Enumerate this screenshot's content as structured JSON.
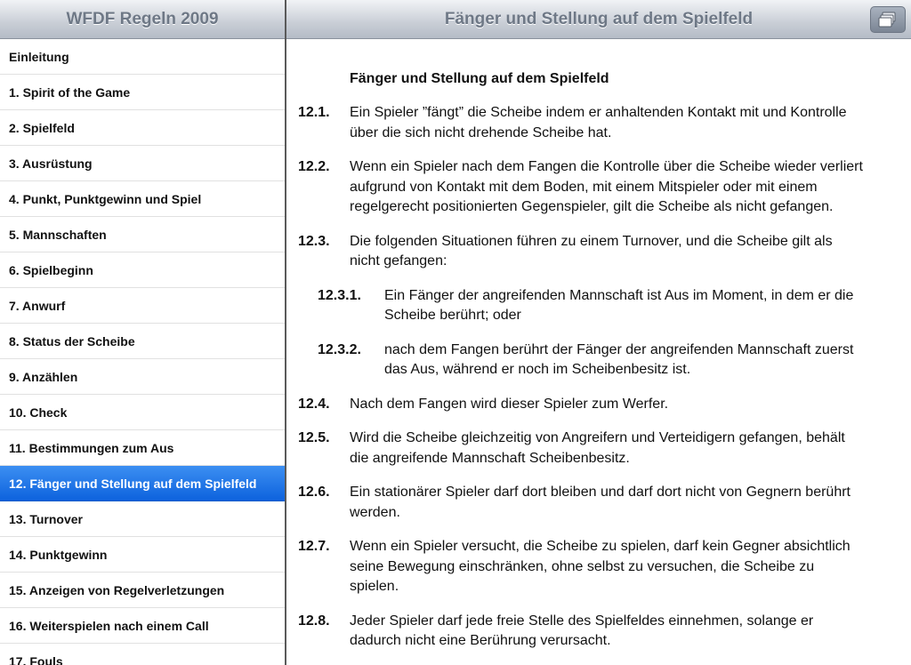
{
  "left_header": {
    "title": "WFDF Regeln 2009"
  },
  "toc": {
    "items": [
      "Einleitung",
      "1. Spirit of the Game",
      "2. Spielfeld",
      "3. Ausrüstung",
      "4. Punkt, Punktgewinn und Spiel",
      "5. Mannschaften",
      "6. Spielbeginn",
      "7. Anwurf",
      "8. Status der Scheibe",
      "9. Anzählen",
      "10. Check",
      "11. Bestimmungen zum Aus",
      "12. Fänger und Stellung auf dem Spielfeld",
      "13. Turnover",
      "14. Punktgewinn",
      "15. Anzeigen von Regelverletzungen",
      "16. Weiterspielen nach einem Call",
      "17. Fouls"
    ],
    "selected": "12. Fänger und Stellung auf dem Spielfeld"
  },
  "right_header": {
    "title": "Fänger und Stellung auf dem Spielfeld",
    "button_icon": "cards-icon"
  },
  "content": {
    "section_title": "Fänger und Stellung auf dem Spielfeld",
    "rules": [
      {
        "num": "12.1.",
        "text": "Ein Spieler ”fängt” die Scheibe indem er anhaltenden Kontakt mit und Kontrolle über die sich nicht drehende Scheibe hat."
      },
      {
        "num": "12.2.",
        "text": "Wenn ein Spieler nach dem Fangen die Kontrolle über die Scheibe wieder verliert aufgrund von Kontakt mit dem Boden, mit einem Mitspieler oder mit einem regelgerecht positionierten Gegenspieler, gilt die Scheibe als nicht gefangen."
      },
      {
        "num": "12.3.",
        "text": "Die folgenden Situationen führen zu einem Turnover, und die Scheibe gilt als nicht gefangen:"
      },
      {
        "num": "12.3.1.",
        "text": "Ein Fänger der angreifenden Mannschaft ist Aus im Moment, in dem er die Scheibe berührt; oder"
      },
      {
        "num": "12.3.2.",
        "text": "nach dem Fangen berührt der Fänger der angreifenden Mannschaft zuerst das Aus, während er noch im Scheibenbesitz ist."
      },
      {
        "num": "12.4.",
        "text": "Nach dem Fangen wird dieser Spieler zum Werfer."
      },
      {
        "num": "12.5.",
        "text": "Wird die Scheibe gleichzeitig von Angreifern und Verteidigern gefangen, behält die angreifende Mannschaft Scheibenbesitz."
      },
      {
        "num": "12.6.",
        "text": "Ein stationärer Spieler darf dort bleiben und darf dort nicht von Gegnern berührt werden."
      },
      {
        "num": "12.7.",
        "text": "Wenn ein Spieler versucht, die Scheibe zu spielen, darf kein Gegner absichtlich seine Bewegung einschränken, ohne selbst zu versuchen, die Scheibe zu spielen."
      },
      {
        "num": "12.8.",
        "text": "Jeder Spieler darf jede freie Stelle des Spielfeldes einnehmen, solange er dadurch nicht eine Berührung verursacht."
      }
    ]
  }
}
